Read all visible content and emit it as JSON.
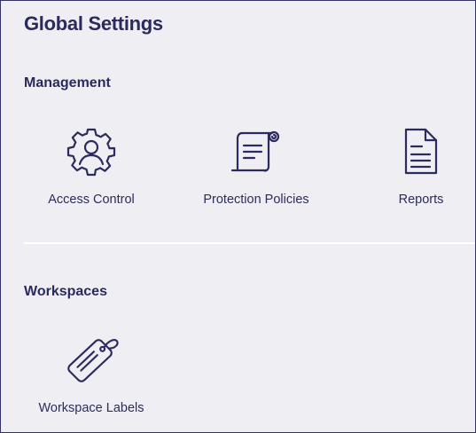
{
  "page": {
    "title": "Global Settings"
  },
  "sections": [
    {
      "heading": "Management",
      "items": [
        {
          "label": "Access Control",
          "icon": "gear-user-icon"
        },
        {
          "label": "Protection Policies",
          "icon": "scroll-icon"
        },
        {
          "label": "Reports",
          "icon": "document-icon"
        }
      ]
    },
    {
      "heading": "Workspaces",
      "items": [
        {
          "label": "Workspace Labels",
          "icon": "tag-icon"
        }
      ]
    }
  ],
  "colors": {
    "background": "#efeef3",
    "text": "#2a2a5e",
    "icon": "#2b2b5f",
    "divider": "#ffffff",
    "border": "#33336a"
  }
}
